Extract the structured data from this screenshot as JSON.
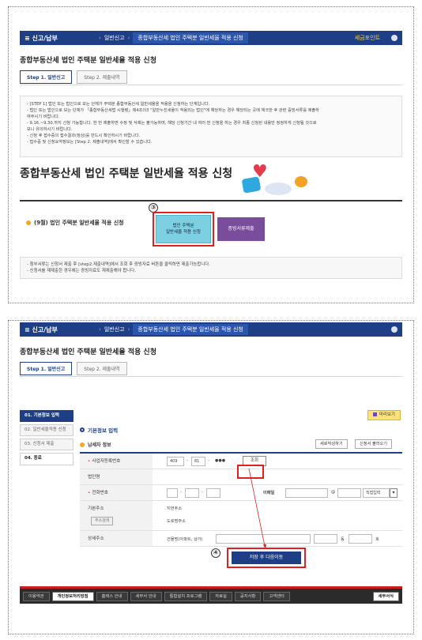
{
  "nav": {
    "brand": "≡ 신고/납부",
    "crumb1": "일반신고",
    "crumb2": "종합부동산세 법인 주택분 일반세율 적용 신청",
    "user": "세금포인트"
  },
  "page_title": "종합부동산세 법인 주택분 일반세율 적용 신청",
  "tabs": [
    "Step 1. 일반신고",
    "Step 2. 제출내역"
  ],
  "guide": [
    "- [STEP 1] 법인 또는 법인으로 보는 단체가 주택분 종합부동산세 일반세율을 적용을 신청하는 단계입니다.",
    "- 법인 또는 법인으로 보는 단체가 「종합부동산세법 시행령」제4조의3 \"일반누진세율이 적용되는 법인\"에 해당하는 경우 해당되는 곳에 체크한 후 관련 증빙서류를 제출하",
    "  여주시기 바랍니다.",
    "- 9.16.~9.30.까지 신청 가능합니다. 한 번 제출하면 수정 및 삭제는 불가능하며, 해당 신청기간 내 여러 번 신청을 하는 경우 최종 신청된 내용만 정정하게 신청될 것으로",
    "  보니 유의하시기 바랍니다.",
    "- 신청 후 접수증의 접수결과(정상)를 반드시 확인하시기 바랍니다.",
    "- 접수증 및 신청요약정보는 [Step 2. 제출내역]에서 확인할 수 있습니다."
  ],
  "big_title": "종합부동산세 법인 주택분 일반세율 적용 신청",
  "apply_row": "(9월) 법인 주택분 일반세율 적용 신청",
  "marker1": "③",
  "marker2": "④",
  "apply_button": [
    "법인 주택분",
    "일반세율 적용 신청"
  ],
  "docs_button": "증빙서류제출",
  "notice": [
    "- 첨부서류는 신청서 제출 후 [step2.제출내역]에서 조회 후 증빙자료 버튼을 클릭하면 제출가능합니다.",
    "- 신청서를 재제출한 경우에는 증빙자료도 재제출해야 합니다."
  ],
  "sidebar": [
    "01. 기본정보 입력",
    "02. 일반세율적용 신청",
    "03. 신청서 제출",
    "04. 종료"
  ],
  "preview": "미리보기",
  "section_basic": "기본정보 입력",
  "section_taxpayer": "납세자 정보",
  "btn_new": "새로작성하기",
  "btn_load": "신청서 불러오기",
  "form": {
    "bizno_label": "사업자등록번호",
    "bizno_a": "409",
    "bizno_b": "81",
    "bizno_c": "●●●",
    "search": "조회",
    "corp_label": "법인명",
    "phone_label": "전화번호",
    "email_label": "이메일",
    "at": "@",
    "direct": "직접입력",
    "addr_label": "기본주소",
    "addr_search": "주소검색",
    "addr_jibun": "지번주소",
    "addr_road": "도로명주소",
    "detail_label": "상세주소",
    "detail_ph": "건물명(아파트, 상가)",
    "dong": "동",
    "ho": "호",
    "save": "저장 후 다음이동"
  },
  "footer": [
    "이용약관",
    "개인정보처리방침",
    "홈택스 안내",
    "세무서 안내",
    "통합설치 프로그램",
    "자료실",
    "공지사항",
    "고객센터",
    "세무서식"
  ]
}
